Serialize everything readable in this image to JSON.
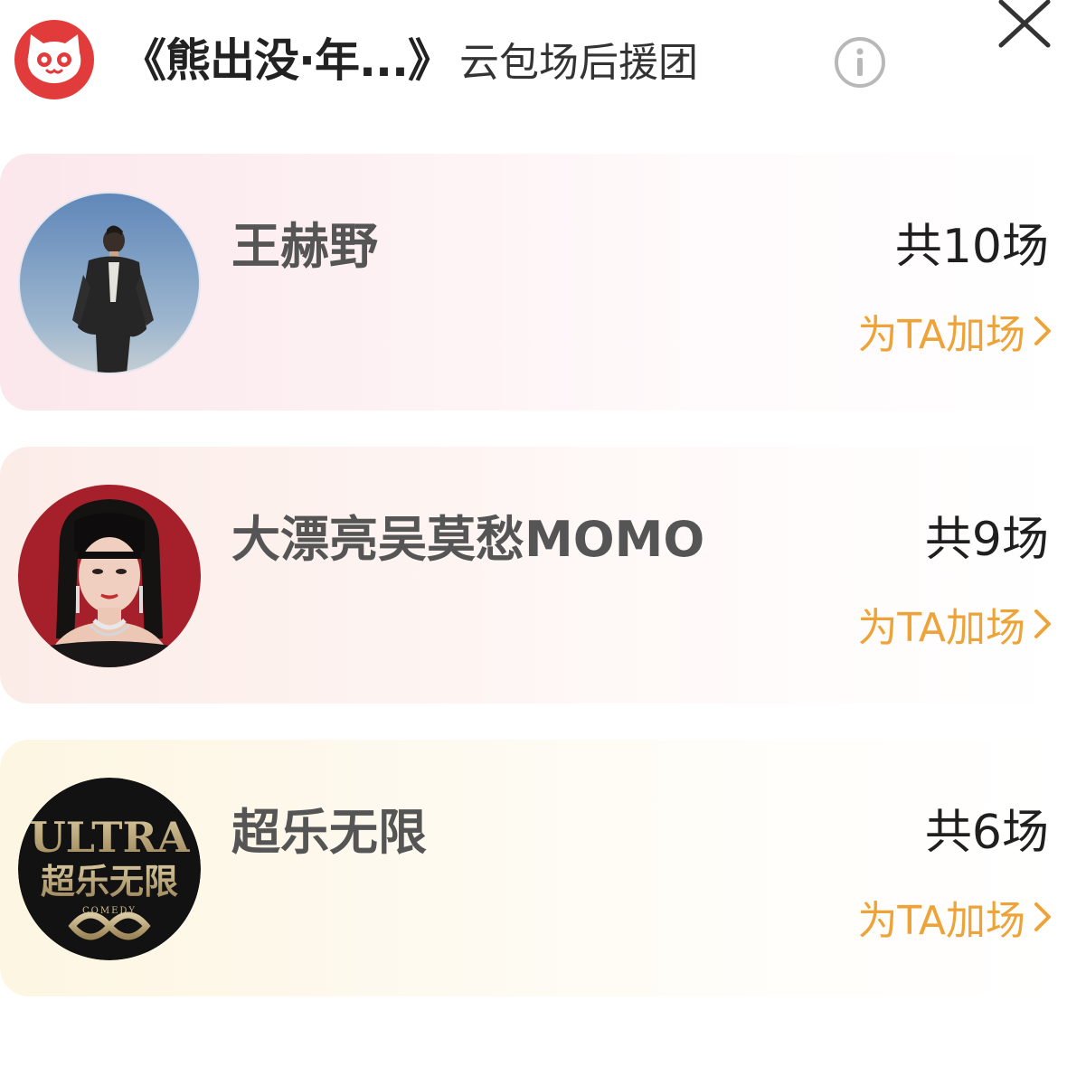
{
  "header": {
    "title_main": "《熊出没·年...》",
    "title_sub": "云包场后援团"
  },
  "colors": {
    "accent_orange": "#eda338",
    "logo_red": "#e23b3b"
  },
  "icons": {
    "logo": "maoyan-cat-logo-icon",
    "info": "info-icon",
    "close": "close-icon",
    "chevron": "chevron-right-icon"
  },
  "supporters": [
    {
      "name": "王赫野",
      "count": "共10场",
      "action": "为TA加场"
    },
    {
      "name": "大漂亮吴莫愁MOMO",
      "count": "共9场",
      "action": "为TA加场"
    },
    {
      "name": "超乐无限",
      "count": "共6场",
      "action": "为TA加场",
      "logo_text_top": "ULTRA",
      "logo_text_cn": "超乐无限",
      "logo_text_arc": "COMEDY"
    }
  ]
}
